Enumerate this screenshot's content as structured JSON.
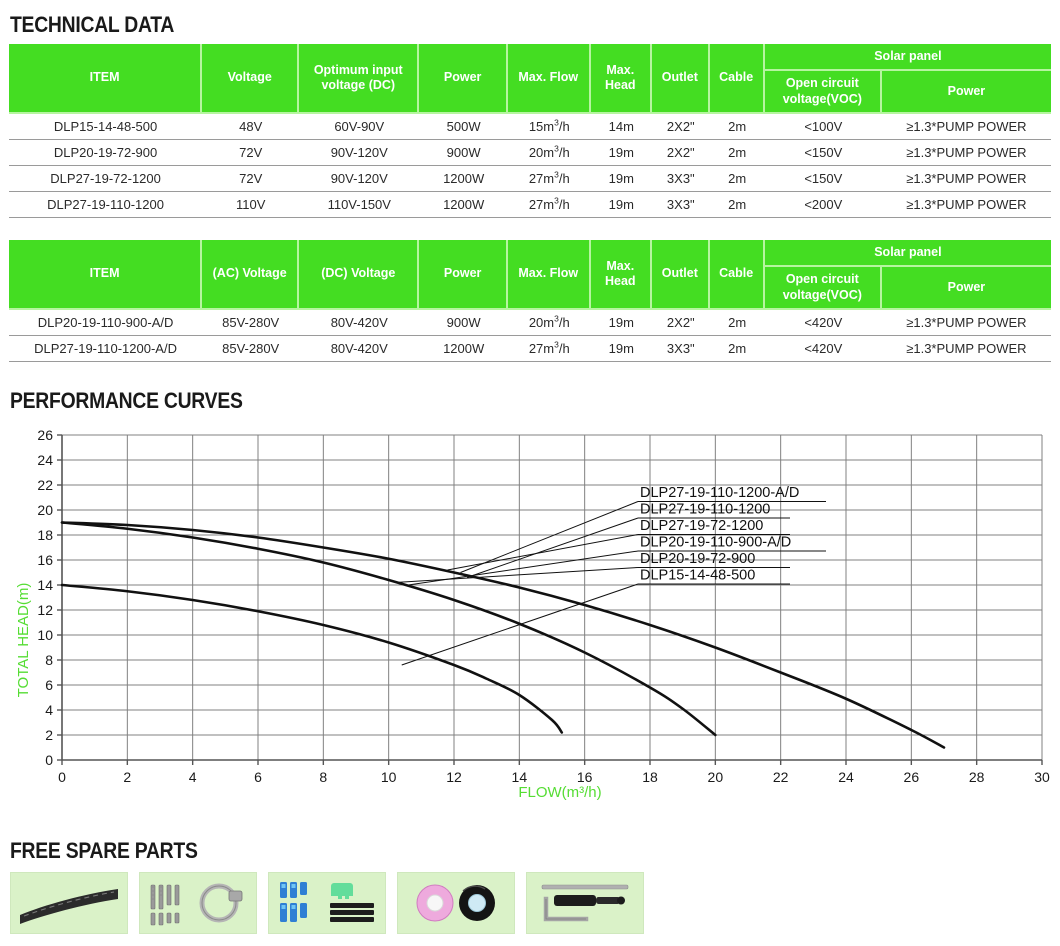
{
  "sections": {
    "technical_data_title": "TECHNICAL DATA",
    "performance_curves_title": "PERFORMANCE CURVES",
    "free_spare_parts_title": "FREE SPARE PARTS"
  },
  "colors": {
    "header_green": "#44dd22",
    "axis_label_green": "#55dd33",
    "tile_green": "#daf2c8",
    "header_divider": "#b6f5a0",
    "row_line": "#9a9a9a",
    "curve_black": "#111111",
    "grid_gray": "#808080"
  },
  "table_dc": {
    "headers": {
      "item": "ITEM",
      "voltage": "Voltage",
      "optimum_input_voltage": "Optimum input voltage (DC)",
      "power": "Power",
      "max_flow": "Max. Flow",
      "max_head": "Max. Head",
      "outlet": "Outlet",
      "cable": "Cable",
      "solar_panel": "Solar panel",
      "open_circuit_voltage": "Open circuit voltage(VOC)",
      "solar_power": "Power"
    },
    "rows": [
      {
        "item": "DLP15-14-48-500",
        "voltage": "48V",
        "optimum_input_voltage": "60V-90V",
        "power": "500W",
        "max_flow_num": "15",
        "max_flow_unit": "/h",
        "max_flow": "15m3/h",
        "max_head": "14m",
        "outlet": "2X2\"",
        "cable": "2m",
        "open_circuit_voltage": "<100V",
        "solar_power": "≥1.3*PUMP POWER"
      },
      {
        "item": "DLP20-19-72-900",
        "voltage": "72V",
        "optimum_input_voltage": "90V-120V",
        "power": "900W",
        "max_flow_num": "20",
        "max_flow_unit": "/h",
        "max_flow": "20m3/h",
        "max_head": "19m",
        "outlet": "2X2\"",
        "cable": "2m",
        "open_circuit_voltage": "<150V",
        "solar_power": "≥1.3*PUMP POWER"
      },
      {
        "item": "DLP27-19-72-1200",
        "voltage": "72V",
        "optimum_input_voltage": "90V-120V",
        "power": "1200W",
        "max_flow_num": "27",
        "max_flow_unit": "/h",
        "max_flow": "27m3/h",
        "max_head": "19m",
        "outlet": "3X3\"",
        "cable": "2m",
        "open_circuit_voltage": "<150V",
        "solar_power": "≥1.3*PUMP POWER"
      },
      {
        "item": "DLP27-19-110-1200",
        "voltage": "110V",
        "optimum_input_voltage": "110V-150V",
        "power": "1200W",
        "max_flow_num": "27",
        "max_flow_unit": "/h",
        "max_flow": "27m3/h",
        "max_head": "19m",
        "outlet": "3X3\"",
        "cable": "2m",
        "open_circuit_voltage": "<200V",
        "solar_power": "≥1.3*PUMP POWER"
      }
    ]
  },
  "table_acdc": {
    "headers": {
      "item": "ITEM",
      "ac_voltage": "(AC) Voltage",
      "dc_voltage": "(DC) Voltage",
      "power": "Power",
      "max_flow": "Max. Flow",
      "max_head": "Max. Head",
      "outlet": "Outlet",
      "cable": "Cable",
      "solar_panel": "Solar panel",
      "open_circuit_voltage": "Open circuit voltage(VOC)",
      "solar_power": "Power"
    },
    "rows": [
      {
        "item": "DLP20-19-110-900-A/D",
        "ac_voltage": "85V-280V",
        "dc_voltage": "80V-420V",
        "power": "900W",
        "max_flow_num": "20",
        "max_flow_unit": "/h",
        "max_flow": "20m3/h",
        "max_head": "19m",
        "outlet": "2X2\"",
        "cable": "2m",
        "open_circuit_voltage": "<420V",
        "solar_power": "≥1.3*PUMP POWER"
      },
      {
        "item": "DLP27-19-110-1200-A/D",
        "ac_voltage": "85V-280V",
        "dc_voltage": "80V-420V",
        "power": "1200W",
        "max_flow_num": "27",
        "max_flow_unit": "/h",
        "max_flow": "27m3/h",
        "max_head": "19m",
        "outlet": "3X3\"",
        "cable": "2m",
        "open_circuit_voltage": "<420V",
        "solar_power": "≥1.3*PUMP POWER"
      }
    ]
  },
  "chart_data": {
    "type": "line",
    "title": "PERFORMANCE CURVES",
    "xlabel": "FLOW(m3/h)",
    "ylabel": "TOTAL HEAD(m)",
    "xlim": [
      0,
      30
    ],
    "ylim": [
      0,
      26
    ],
    "xticks": [
      0,
      2,
      4,
      6,
      8,
      10,
      12,
      14,
      16,
      18,
      20,
      22,
      24,
      26,
      28,
      30
    ],
    "yticks": [
      0,
      2,
      4,
      6,
      8,
      10,
      12,
      14,
      16,
      18,
      20,
      22,
      24,
      26
    ],
    "grid": true,
    "legend_position": "inside-right",
    "series": [
      {
        "name": "DLP27-19-110-1200-A/D",
        "points": [
          [
            0,
            19.0
          ],
          [
            2,
            18.8
          ],
          [
            4,
            18.4
          ],
          [
            6,
            17.8
          ],
          [
            8,
            17.0
          ],
          [
            10,
            16.1
          ],
          [
            12,
            15.0
          ],
          [
            14,
            13.8
          ],
          [
            16,
            12.4
          ],
          [
            18,
            10.8
          ],
          [
            20,
            9.0
          ],
          [
            22,
            7.0
          ],
          [
            24,
            4.9
          ],
          [
            26,
            2.4
          ],
          [
            27,
            1.0
          ]
        ]
      },
      {
        "name": "DLP27-19-110-1200",
        "points": [
          [
            0,
            19.0
          ],
          [
            2,
            18.8
          ],
          [
            4,
            18.4
          ],
          [
            6,
            17.8
          ],
          [
            8,
            17.0
          ],
          [
            10,
            16.1
          ],
          [
            12,
            15.0
          ],
          [
            14,
            13.8
          ],
          [
            16,
            12.4
          ],
          [
            18,
            10.8
          ],
          [
            20,
            9.0
          ],
          [
            22,
            7.0
          ],
          [
            24,
            4.9
          ],
          [
            26,
            2.4
          ],
          [
            27,
            1.0
          ]
        ]
      },
      {
        "name": "DLP27-19-72-1200",
        "points": [
          [
            0,
            19.0
          ],
          [
            2,
            18.8
          ],
          [
            4,
            18.4
          ],
          [
            6,
            17.8
          ],
          [
            8,
            17.0
          ],
          [
            10,
            16.1
          ],
          [
            12,
            15.0
          ],
          [
            14,
            13.8
          ],
          [
            16,
            12.4
          ],
          [
            18,
            10.8
          ],
          [
            20,
            9.0
          ],
          [
            22,
            7.0
          ],
          [
            24,
            4.9
          ],
          [
            26,
            2.4
          ],
          [
            27,
            1.0
          ]
        ]
      },
      {
        "name": "DLP20-19-110-900-A/D",
        "points": [
          [
            0,
            19.0
          ],
          [
            2,
            18.5
          ],
          [
            4,
            17.8
          ],
          [
            6,
            16.9
          ],
          [
            8,
            15.8
          ],
          [
            10,
            14.4
          ],
          [
            12,
            12.8
          ],
          [
            14,
            10.9
          ],
          [
            16,
            8.6
          ],
          [
            18,
            5.8
          ],
          [
            19,
            4.1
          ],
          [
            20,
            2.0
          ]
        ]
      },
      {
        "name": "DLP20-19-72-900",
        "points": [
          [
            0,
            19.0
          ],
          [
            2,
            18.5
          ],
          [
            4,
            17.8
          ],
          [
            6,
            16.9
          ],
          [
            8,
            15.8
          ],
          [
            10,
            14.4
          ],
          [
            12,
            12.8
          ],
          [
            14,
            10.9
          ],
          [
            16,
            8.6
          ],
          [
            18,
            5.8
          ],
          [
            19,
            4.1
          ],
          [
            20,
            2.0
          ]
        ]
      },
      {
        "name": "DLP15-14-48-500",
        "points": [
          [
            0,
            14.0
          ],
          [
            2,
            13.5
          ],
          [
            4,
            12.8
          ],
          [
            6,
            11.9
          ],
          [
            8,
            10.8
          ],
          [
            10,
            9.4
          ],
          [
            12,
            7.6
          ],
          [
            13,
            6.5
          ],
          [
            14,
            5.2
          ],
          [
            15,
            3.2
          ],
          [
            15.3,
            2.2
          ]
        ]
      }
    ],
    "legend_labels": [
      "DLP27-19-110-1200-A/D",
      "DLP27-19-110-1200",
      "DLP27-19-72-1200",
      "DLP20-19-110-900-A/D",
      "DLP20-19-72-900",
      "DLP15-14-48-500"
    ]
  },
  "spare_parts": [
    {
      "name": "hose-pipe"
    },
    {
      "name": "screws-and-clamp"
    },
    {
      "name": "connectors-and-fins"
    },
    {
      "name": "tape-rolls"
    },
    {
      "name": "screwdriver-and-hex-key"
    }
  ]
}
